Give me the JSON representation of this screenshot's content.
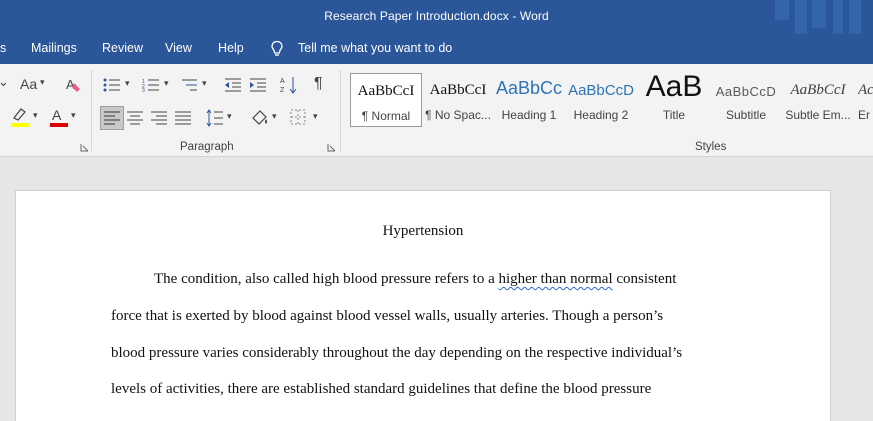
{
  "window": {
    "title": "Research Paper Introduction.docx  -  Word"
  },
  "menu": {
    "items": [
      "s",
      "Mailings",
      "Review",
      "View",
      "Help"
    ],
    "tell_me": "Tell me what you want to do"
  },
  "ribbon": {
    "font_size_label": "Aa",
    "paragraph_label": "Paragraph",
    "styles_label": "Styles",
    "pilcrow": "¶",
    "styles": [
      {
        "sample": "AaBbCcI",
        "name": "¶ Normal"
      },
      {
        "sample": "AaBbCcI",
        "name": "¶ No Spac..."
      },
      {
        "sample": "AaBbCc",
        "name": "Heading 1"
      },
      {
        "sample": "AaBbCcD",
        "name": "Heading 2"
      },
      {
        "sample": "AaB",
        "name": "Title"
      },
      {
        "sample": "AaBbCcD",
        "name": "Subtitle"
      },
      {
        "sample": "AaBbCcI",
        "name": "Subtle Em..."
      },
      {
        "sample": "Ac",
        "name": "Er"
      }
    ]
  },
  "document": {
    "title": "Hypertension",
    "line1_before": "The condition, also called high blood pressure refers to a ",
    "line1_squiggle": "higher than normal",
    "line1_after": " consistent",
    "line2": "force that is exerted by blood against blood vessel walls, usually arteries. Though a person’s",
    "line3": "blood pressure varies considerably throughout the day depending on the respective individual’s",
    "line4": "levels of activities, there are established standard guidelines that define the blood pressure"
  },
  "colors": {
    "accent": "#2b579a",
    "font_color_red": "#e00000",
    "highlight_yellow": "#ffff00"
  }
}
